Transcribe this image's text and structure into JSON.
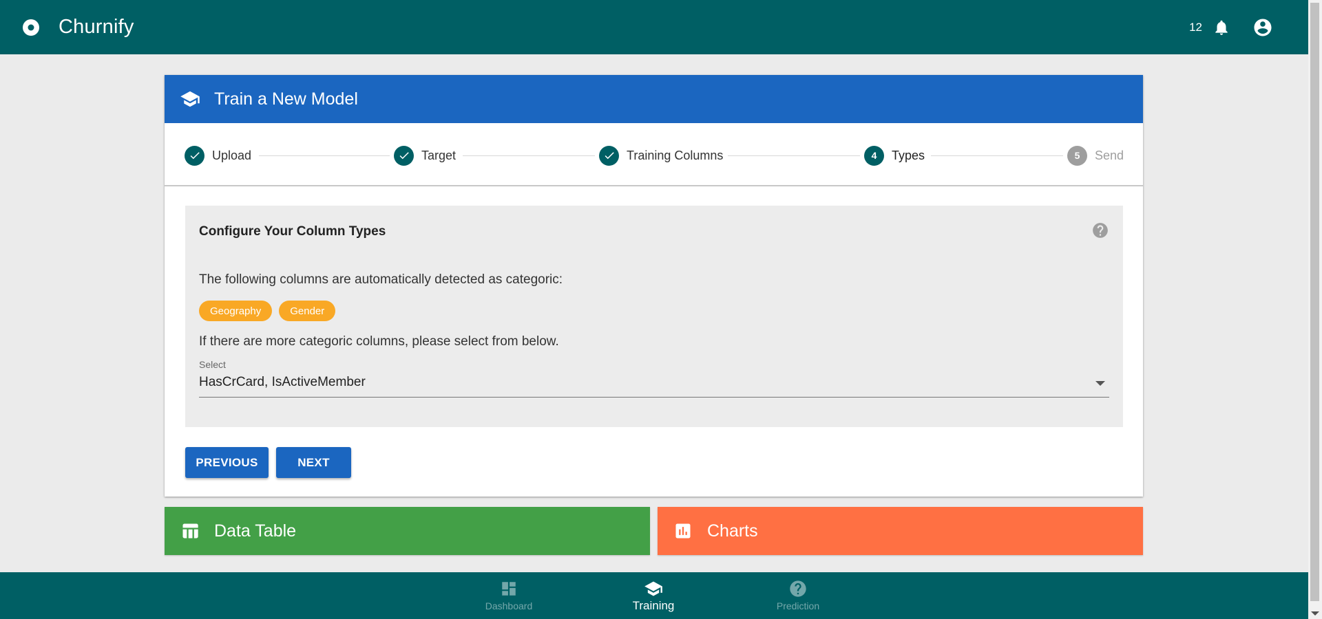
{
  "app": {
    "title": "Churnify",
    "notification_count": "12"
  },
  "card": {
    "title": "Train a New Model"
  },
  "stepper": {
    "steps": [
      {
        "label": "Upload",
        "state": "done",
        "number": ""
      },
      {
        "label": "Target",
        "state": "done",
        "number": ""
      },
      {
        "label": "Training Columns",
        "state": "done",
        "number": ""
      },
      {
        "label": "Types",
        "state": "active",
        "number": "4"
      },
      {
        "label": "Send",
        "state": "pending",
        "number": "5"
      }
    ]
  },
  "panel": {
    "title": "Configure Your Column Types",
    "detected_text": "The following columns are automatically detected as categoric:",
    "chips": [
      "Geography",
      "Gender"
    ],
    "more_text": "If there are more categoric columns, please select from below.",
    "select": {
      "label": "Select",
      "value": "HasCrCard, IsActiveMember"
    }
  },
  "buttons": {
    "previous": "PREVIOUS",
    "next": "NEXT"
  },
  "sections": {
    "data_table": "Data Table",
    "charts": "Charts"
  },
  "bottom_nav": {
    "items": [
      {
        "label": "Dashboard",
        "icon": "dashboard-icon",
        "active": false
      },
      {
        "label": "Training",
        "icon": "school-icon",
        "active": true
      },
      {
        "label": "Prediction",
        "icon": "help-icon",
        "active": false
      }
    ]
  },
  "colors": {
    "app_bar": "#005f64",
    "primary": "#1b66c0",
    "chip": "#f9a825",
    "data_table": "#43a047",
    "charts": "#ff7043"
  }
}
